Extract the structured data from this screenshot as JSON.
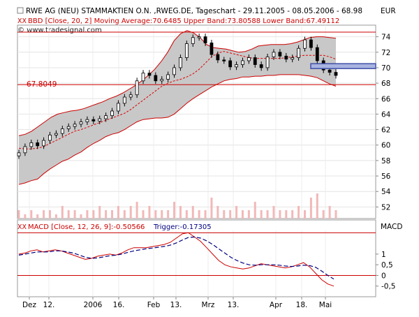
{
  "header": {
    "title": "RWE AG (NEU) STAMMAKTIEN O.N. ,RWEG.DE, Tageschart - 29.11.2005 - 08.05.2006 - 68.98",
    "currency": "EUR",
    "indicator_label": "BBD [Close, 20, 2] Moving Average:70.6485 Upper Band:73.80588 Lower Band:67.49112",
    "copyright": "© www.tradesignal.com"
  },
  "macd_panel": {
    "label": "MACD [Close, 12, 26, 9]:-0.50566",
    "trigger": "Trigger:-0.17305",
    "axis_title": "MACD"
  },
  "colors": {
    "price_line": "#cc0000",
    "band_fill": "#c8c8c8",
    "moving_average": "#dd0000",
    "candle": "#000000",
    "volume_bars": "#f2b8b8",
    "macd_line": "#cc0000",
    "trigger_line": "#000080",
    "marker": "#4050a8"
  },
  "chart_data": [
    {
      "type": "candlestick",
      "title": "RWE AG (NEU) STAMMAKTIEN O.N. ,RWEG.DE, Tageschart - 29.11.2005 - 08.05.2006 - 68.98",
      "x_tick_labels": [
        "Dez",
        "12.",
        "2006",
        "16.",
        "Feb",
        "13.",
        "Mrz",
        "13.",
        "Apr",
        "18.",
        "Mai"
      ],
      "y_tick_labels": [
        52,
        54,
        56,
        58,
        60,
        62,
        64,
        66,
        68,
        70,
        72,
        74
      ],
      "ylim": [
        50.5,
        75.5
      ],
      "grid": true,
      "horizontal_lines": [
        {
          "value": 67.8049,
          "label": "67.8049"
        },
        {
          "value": 74.6,
          "label": ""
        }
      ],
      "marker": {
        "value": 70.2
      },
      "series": [
        {
          "name": "Moving Average",
          "values": [
            59.6,
            59.5,
            59.5,
            59.6,
            59.8,
            60.2,
            60.6,
            61.0,
            61.4,
            61.8,
            62.0,
            62.3,
            62.6,
            62.9,
            63.2,
            63.5,
            63.8,
            64.1,
            64.6,
            65.2,
            65.8,
            66.4,
            67.0,
            67.6,
            68.0,
            68.3,
            68.5,
            68.8,
            69.2,
            69.8,
            70.6,
            71.4,
            71.9,
            72.1,
            71.9,
            71.7,
            71.5,
            71.3,
            71.2,
            71.2,
            71.2,
            71.2,
            71.2,
            71.3,
            71.4,
            71.5,
            71.6,
            71.6,
            71.6,
            71.6,
            71.4,
            71.1
          ]
        },
        {
          "name": "Upper Band",
          "values": [
            61.2,
            61.4,
            61.8,
            62.4,
            63.0,
            63.6,
            64.0,
            64.2,
            64.4,
            64.5,
            64.7,
            65.0,
            65.3,
            65.6,
            66.0,
            66.3,
            66.7,
            67.2,
            67.7,
            68.3,
            69.0,
            69.8,
            70.8,
            72.0,
            73.5,
            74.4,
            74.8,
            74.5,
            73.9,
            73.0,
            72.6,
            72.5,
            72.4,
            72.2,
            72.0,
            72.1,
            72.4,
            72.8,
            72.9,
            73.0,
            73.0,
            73.0,
            73.1,
            73.3,
            73.6,
            73.9,
            74.0,
            74.0,
            73.9,
            73.8
          ]
        },
        {
          "name": "Lower Band",
          "values": [
            54.9,
            55.1,
            55.4,
            55.6,
            56.3,
            56.9,
            57.4,
            57.9,
            58.2,
            58.7,
            59.1,
            59.7,
            60.2,
            60.6,
            61.1,
            61.4,
            61.6,
            62.0,
            62.5,
            63.0,
            63.3,
            63.4,
            63.5,
            63.5,
            63.6,
            64.0,
            64.7,
            65.4,
            66.0,
            66.5,
            67.0,
            67.5,
            67.9,
            68.3,
            68.5,
            68.6,
            68.8,
            68.8,
            68.9,
            68.9,
            69.0,
            69.0,
            69.1,
            69.1,
            69.1,
            69.1,
            69.0,
            68.9,
            68.7,
            68.3,
            67.9,
            67.6
          ]
        },
        {
          "name": "Close",
          "values": [
            59.0,
            59.8,
            60.3,
            59.9,
            60.6,
            61.3,
            61.5,
            62.1,
            62.4,
            62.7,
            63.0,
            63.3,
            63.1,
            63.4,
            63.8,
            64.4,
            65.4,
            66.2,
            66.5,
            68.3,
            69.3,
            69.0,
            68.3,
            68.5,
            69.1,
            70.0,
            71.3,
            73.1,
            73.9,
            74.0,
            73.2,
            71.7,
            71.0,
            70.9,
            70.1,
            70.4,
            70.9,
            71.3,
            70.4,
            70.0,
            71.4,
            72.0,
            71.5,
            71.1,
            71.3,
            72.5,
            73.6,
            72.6,
            70.9,
            69.7,
            69.4,
            69.0
          ]
        },
        {
          "name": "Volume",
          "values": [
            2,
            1,
            2,
            1,
            2,
            2,
            1,
            3,
            2,
            2,
            1,
            2,
            2,
            3,
            2,
            2,
            3,
            2,
            3,
            4,
            2,
            3,
            2,
            2,
            2,
            4,
            3,
            2,
            3,
            2,
            2,
            5,
            3,
            2,
            2,
            3,
            2,
            2,
            4,
            2,
            2,
            3,
            2,
            2,
            2,
            3,
            2,
            5,
            6,
            2,
            3,
            2
          ]
        }
      ]
    },
    {
      "type": "line",
      "title": "MACD [Close, 12, 26, 9]:-0.50566",
      "y_tick_labels": [
        "1",
        "0,5",
        "0",
        "-0,5"
      ],
      "ylim": [
        -1.0,
        2.6
      ],
      "horizontal_lines": [
        {
          "value": 0
        },
        {
          "value": 2.0
        }
      ],
      "series": [
        {
          "name": "MACD",
          "values": [
            1.0,
            1.05,
            1.15,
            1.2,
            1.1,
            1.15,
            1.2,
            1.15,
            1.05,
            0.95,
            0.85,
            0.75,
            0.8,
            0.9,
            0.95,
            1.0,
            0.95,
            1.05,
            1.2,
            1.3,
            1.3,
            1.3,
            1.35,
            1.4,
            1.45,
            1.55,
            1.75,
            1.95,
            2.0,
            1.8,
            1.6,
            1.3,
            1.0,
            0.7,
            0.5,
            0.4,
            0.35,
            0.3,
            0.35,
            0.45,
            0.55,
            0.5,
            0.45,
            0.4,
            0.35,
            0.4,
            0.5,
            0.6,
            0.4,
            0.1,
            -0.2,
            -0.4,
            -0.5
          ]
        },
        {
          "name": "Trigger",
          "values": [
            0.95,
            1.0,
            1.05,
            1.1,
            1.1,
            1.1,
            1.15,
            1.15,
            1.1,
            1.05,
            0.95,
            0.85,
            0.8,
            0.82,
            0.87,
            0.92,
            0.95,
            1.0,
            1.08,
            1.15,
            1.2,
            1.25,
            1.28,
            1.32,
            1.36,
            1.42,
            1.52,
            1.66,
            1.78,
            1.8,
            1.75,
            1.62,
            1.45,
            1.25,
            1.05,
            0.85,
            0.7,
            0.58,
            0.5,
            0.48,
            0.5,
            0.5,
            0.5,
            0.48,
            0.44,
            0.42,
            0.44,
            0.48,
            0.46,
            0.38,
            0.2,
            0.0,
            -0.17
          ]
        }
      ]
    }
  ]
}
